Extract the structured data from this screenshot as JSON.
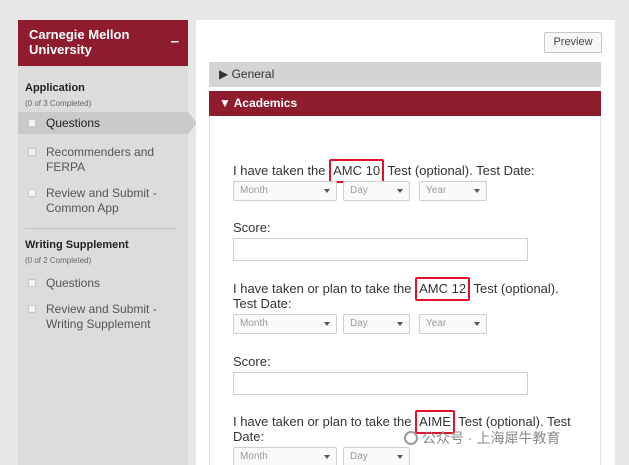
{
  "sidebar": {
    "title": "Carnegie Mellon University",
    "collapse_glyph": "–",
    "application": {
      "title": "Application",
      "count": "(0 of 3 Completed)",
      "items": [
        "Questions",
        "Recommenders and FERPA",
        "Review and Submit - Common App"
      ]
    },
    "writing": {
      "title": "Writing Supplement",
      "count": "(0 of 2 Completed)",
      "items": [
        "Questions",
        "Review and Submit - Writing Supplement"
      ]
    }
  },
  "main": {
    "preview_label": "Preview",
    "general_label": "▶ General",
    "academics_label": "▼ Academics",
    "select_placeholders": {
      "month": "Month",
      "day": "Day",
      "year": "Year"
    },
    "score_label": "Score:",
    "questions": [
      {
        "prefix": "I have taken the ",
        "test": "AMC 10",
        "line1_suffix": " Test (optional). Test Date:",
        "line2": ""
      },
      {
        "prefix": "I have taken or plan to take the ",
        "test": "AMC 12",
        "line1_suffix": " Test (optional).",
        "line2": "Test Date:"
      },
      {
        "prefix": "I have taken or plan to take the ",
        "test": "AIME",
        "line1_suffix": " Test (optional). Test",
        "line2": "Date:"
      }
    ]
  },
  "watermark": {
    "text": "公众号 · 上海犀牛教育"
  }
}
